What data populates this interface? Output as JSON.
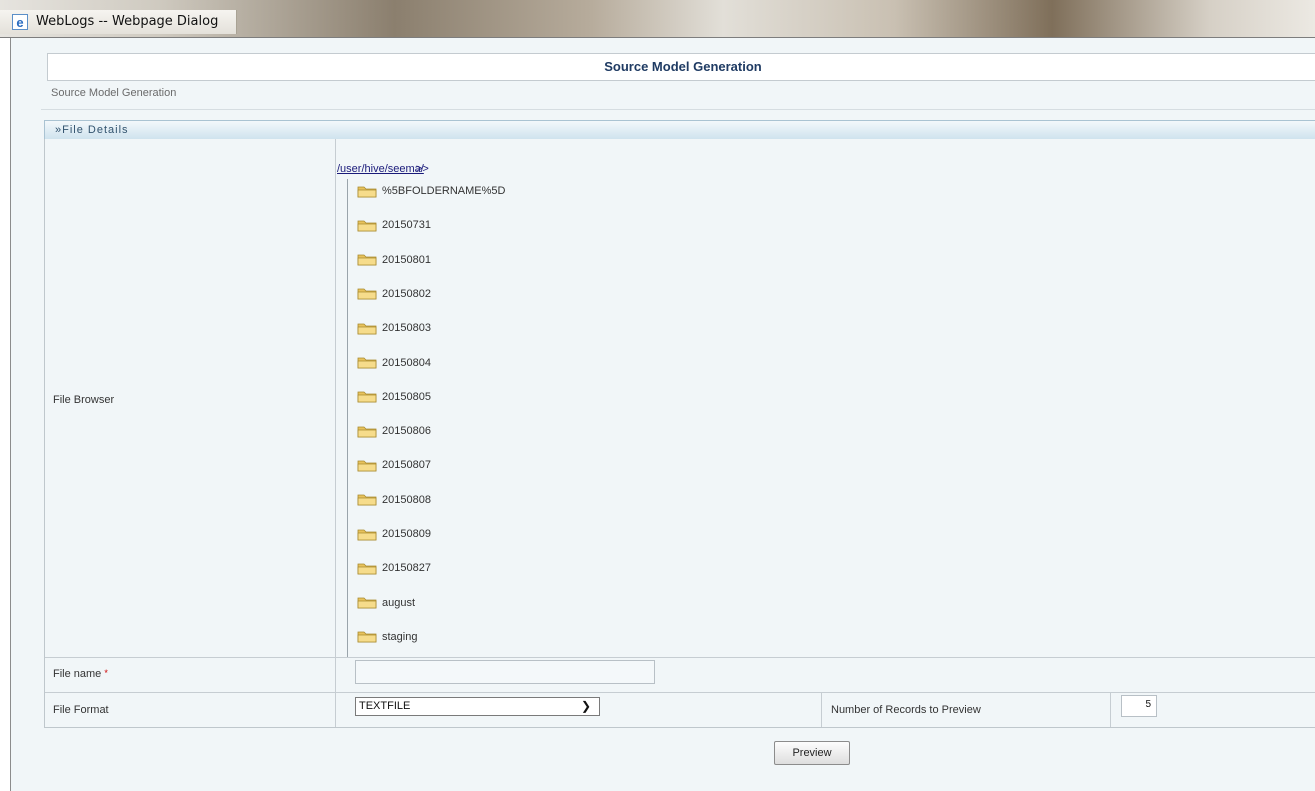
{
  "window": {
    "title": "WebLogs -- Webpage Dialog"
  },
  "page": {
    "header_title": "Source Model Generation",
    "breadcrumb": "Source Model Generation"
  },
  "section": {
    "title": "»File Details"
  },
  "file_browser": {
    "label": "File Browser",
    "path": "/user/hive/seema/",
    "nav_arrow": ">>",
    "folders": [
      "%5BFOLDERNAME%5D",
      "20150731",
      "20150801",
      "20150802",
      "20150803",
      "20150804",
      "20150805",
      "20150806",
      "20150807",
      "20150808",
      "20150809",
      "20150827",
      "august",
      "staging"
    ]
  },
  "file_name": {
    "label": "File name",
    "required_marker": "*",
    "value": ""
  },
  "file_format": {
    "label": "File Format",
    "selected": "TEXTFILE"
  },
  "records_preview": {
    "label": "Number of Records to Preview",
    "value": "5"
  },
  "actions": {
    "preview_label": "Preview"
  },
  "colors": {
    "header_text": "#1f3b63",
    "section_bg": "#cfe3ee",
    "client_bg": "#f1f6f8",
    "required": "#cc0000",
    "folder_yellow": "#f2d27a"
  },
  "icons": {
    "window": "ie-icon",
    "folder": "folder-icon",
    "dropdown": "chevron-down-icon"
  }
}
